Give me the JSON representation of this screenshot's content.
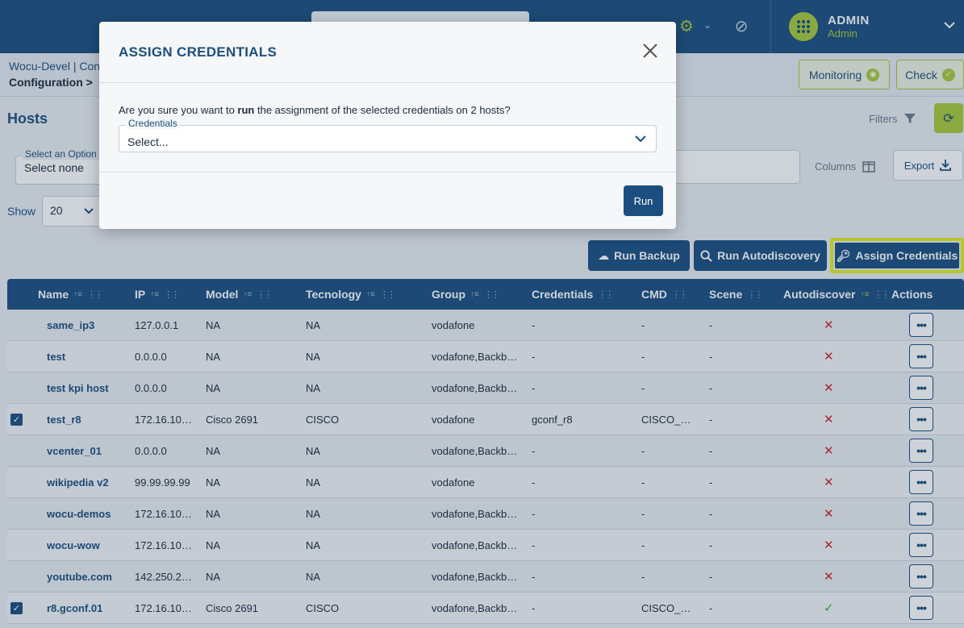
{
  "topbar": {
    "user_name": "ADMIN",
    "user_role": "Admin"
  },
  "breadcrumb": {
    "line1": "Wocu-Devel | Con",
    "line2": "Configuration >"
  },
  "header_buttons": {
    "monitoring": "Monitoring",
    "check": "Check"
  },
  "hosts": {
    "title": "Hosts",
    "filters": "Filters",
    "select_option_label": "Select an Option",
    "select_option_value": "Select none",
    "columns": "Columns",
    "export": "Export",
    "show_label": "Show",
    "show_value": "20"
  },
  "actions": {
    "run_backup": "Run Backup",
    "run_autodiscovery": "Run Autodiscovery",
    "assign_credentials": "Assign Credentials"
  },
  "table": {
    "columns": [
      "Name",
      "IP",
      "Model",
      "Tecnology",
      "Group",
      "Credentials",
      "CMD",
      "Scene",
      "Autodiscover",
      "Actions"
    ],
    "rows": [
      {
        "checked": false,
        "name": "same_ip3",
        "ip": "127.0.0.1",
        "model": "NA",
        "tech": "NA",
        "group": "vodafone",
        "cred": "-",
        "cmd": "-",
        "scene": "-",
        "auto": "✕"
      },
      {
        "checked": false,
        "name": "test",
        "ip": "0.0.0.0",
        "model": "NA",
        "tech": "NA",
        "group": "vodafone,Backb…",
        "cred": "-",
        "cmd": "-",
        "scene": "-",
        "auto": "✕"
      },
      {
        "checked": false,
        "name": "test kpi host",
        "ip": "0.0.0.0",
        "model": "NA",
        "tech": "NA",
        "group": "vodafone,Backb…",
        "cred": "-",
        "cmd": "-",
        "scene": "-",
        "auto": "✕"
      },
      {
        "checked": true,
        "name": "test_r8",
        "ip": "172.16.10…",
        "model": "Cisco 2691",
        "tech": "CISCO",
        "group": "vodafone",
        "cred": "gconf_r8",
        "cmd": "CISCO_…",
        "scene": "-",
        "auto": "✕"
      },
      {
        "checked": false,
        "name": "vcenter_01",
        "ip": "0.0.0.0",
        "model": "NA",
        "tech": "NA",
        "group": "vodafone,Backb…",
        "cred": "-",
        "cmd": "-",
        "scene": "-",
        "auto": "✕"
      },
      {
        "checked": false,
        "name": "wikipedia v2",
        "ip": "99.99.99.99",
        "model": "NA",
        "tech": "NA",
        "group": "vodafone",
        "cred": "-",
        "cmd": "-",
        "scene": "-",
        "auto": "✕"
      },
      {
        "checked": false,
        "name": "wocu-demos",
        "ip": "172.16.10…",
        "model": "NA",
        "tech": "NA",
        "group": "vodafone,Backb…",
        "cred": "-",
        "cmd": "-",
        "scene": "-",
        "auto": "✕"
      },
      {
        "checked": false,
        "name": "wocu-wow",
        "ip": "172.16.10…",
        "model": "NA",
        "tech": "NA",
        "group": "vodafone,Backb…",
        "cred": "-",
        "cmd": "-",
        "scene": "-",
        "auto": "✕"
      },
      {
        "checked": false,
        "name": "youtube.com",
        "ip": "142.250.2…",
        "model": "NA",
        "tech": "NA",
        "group": "vodafone,Backb…",
        "cred": "-",
        "cmd": "-",
        "scene": "-",
        "auto": "✕"
      },
      {
        "checked": true,
        "name": "r8.gconf.01",
        "ip": "172.16.10…",
        "model": "Cisco 2691",
        "tech": "CISCO",
        "group": "vodafone,Backb…",
        "cred": "-",
        "cmd": "CISCO_…",
        "scene": "-",
        "auto": "✓"
      }
    ]
  },
  "modal": {
    "title": "ASSIGN CREDENTIALS",
    "message_pre": "Are you sure you want to ",
    "message_bold": "run",
    "message_post": " the assignment of the selected credentials on 2 hosts?",
    "credentials_label": "Credentials",
    "credentials_placeholder": "Select...",
    "run_label": "Run"
  },
  "colors": {
    "primary": "#1c4f7f",
    "accent": "#a8c93a",
    "highlight": "#e0f01e",
    "error": "#d0202a",
    "success": "#3aa63a"
  }
}
